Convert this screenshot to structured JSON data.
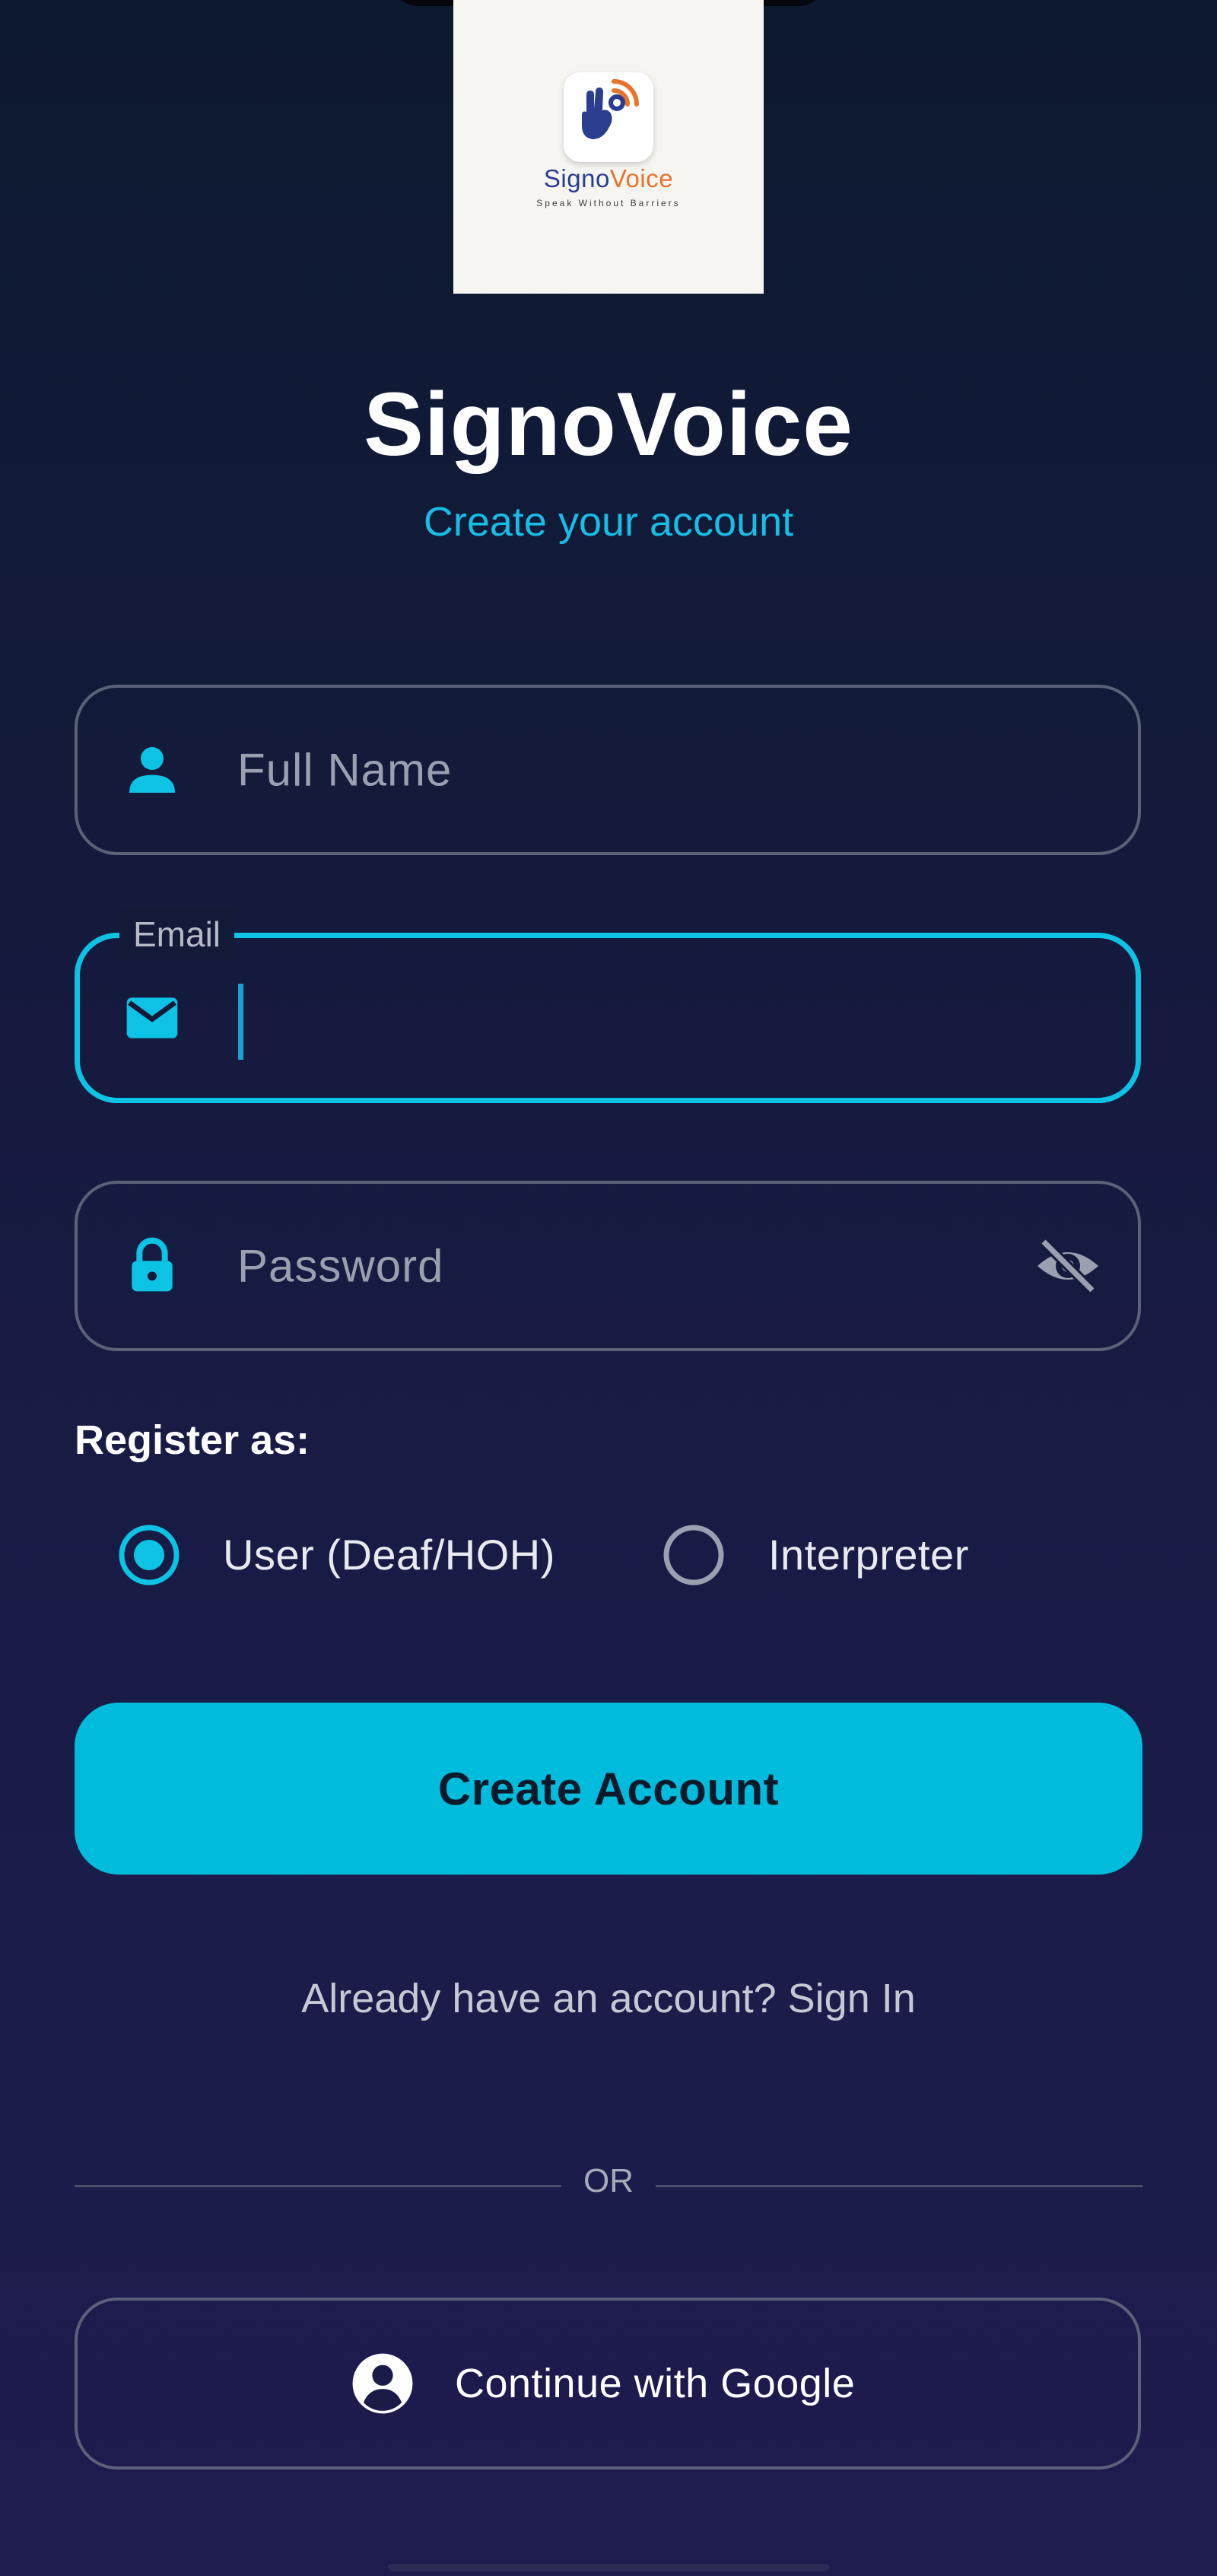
{
  "logo": {
    "brand_part1": "Signo",
    "brand_part2": "Voice",
    "tagline": "Speak Without Barriers"
  },
  "header": {
    "title": "SignoVoice",
    "subtitle": "Create your account"
  },
  "form": {
    "full_name": {
      "placeholder": "Full Name",
      "value": "",
      "icon": "person-icon"
    },
    "email": {
      "label": "Email",
      "value": "",
      "icon": "mail-icon",
      "focused": true
    },
    "password": {
      "placeholder": "Password",
      "value": "",
      "icon": "lock-icon",
      "toggle_icon": "visibility-off-icon"
    },
    "register_as_label": "Register as:",
    "roles": [
      {
        "label": "User (Deaf/HOH)",
        "selected": true
      },
      {
        "label": "Interpreter",
        "selected": false
      }
    ],
    "submit_label": "Create Account"
  },
  "signin_prompt": "Already have an account? Sign In",
  "divider_text": "OR",
  "google": {
    "label": "Continue with Google",
    "icon": "account-circle-icon"
  },
  "colors": {
    "accent": "#00bcdc",
    "background_top": "#0d1930",
    "background_bottom": "#1e1b4f",
    "field_border": "#5a6178"
  }
}
